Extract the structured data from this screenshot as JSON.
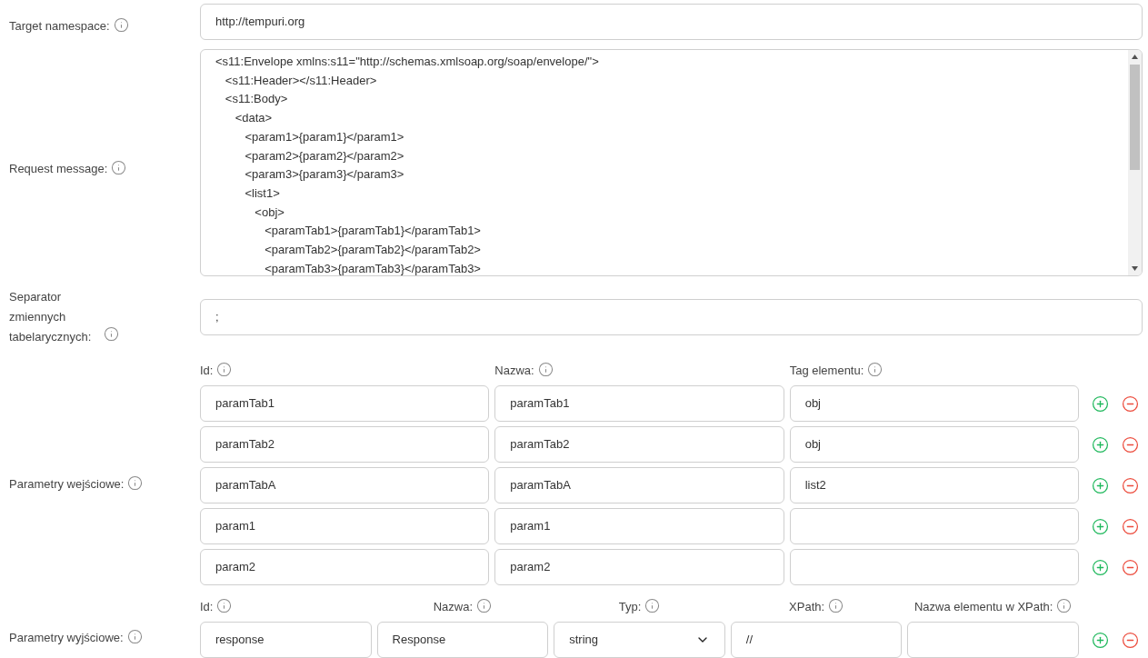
{
  "target_namespace": {
    "label": "Target namespace:",
    "value": "http://tempuri.org"
  },
  "request_message": {
    "label": "Request message:",
    "value": "<s11:Envelope xmlns:s11=\"http://schemas.xmlsoap.org/soap/envelope/\">\n   <s11:Header></s11:Header>\n   <s11:Body>\n      <data>\n         <param1>{param1}</param1>\n         <param2>{param2}</param2>\n         <param3>{param3}</param3>\n         <list1>\n            <obj>\n               <paramTab1>{paramTab1}</paramTab1>\n               <paramTab2>{paramTab2}</paramTab2>\n               <paramTab3>{paramTab3}</paramTab3>"
  },
  "separator": {
    "label": "Separator zmiennych tabelarycznych:",
    "value": ";"
  },
  "input_params": {
    "label": "Parametry wejściowe:",
    "columns": [
      "Id:",
      "Nazwa:",
      "Tag elementu:"
    ],
    "rows": [
      {
        "cells": [
          {
            "value": "paramTab1"
          },
          {
            "value": "paramTab1"
          },
          {
            "value": "obj"
          }
        ]
      },
      {
        "cells": [
          {
            "value": "paramTab2"
          },
          {
            "value": "paramTab2"
          },
          {
            "value": "obj"
          }
        ]
      },
      {
        "cells": [
          {
            "value": "paramTabA"
          },
          {
            "value": "paramTabA"
          },
          {
            "value": "list2"
          }
        ]
      },
      {
        "cells": [
          {
            "value": "param1"
          },
          {
            "value": "param1"
          },
          {}
        ]
      },
      {
        "cells": [
          {
            "value": "param2"
          },
          {
            "value": "param2"
          },
          {}
        ]
      }
    ]
  },
  "output_params": {
    "label": "Parametry wyjściowe:",
    "columns": [
      "Id:",
      "Nazwa:",
      "Typ:",
      "XPath:",
      "Nazwa elementu w XPath:"
    ],
    "rows": [
      {
        "cells": [
          {
            "kind": "input",
            "value": "response"
          },
          {
            "kind": "input",
            "value": "Response"
          },
          {
            "kind": "select",
            "value": "string"
          },
          {
            "kind": "input",
            "value": "//"
          },
          {
            "kind": "input"
          }
        ]
      }
    ]
  }
}
